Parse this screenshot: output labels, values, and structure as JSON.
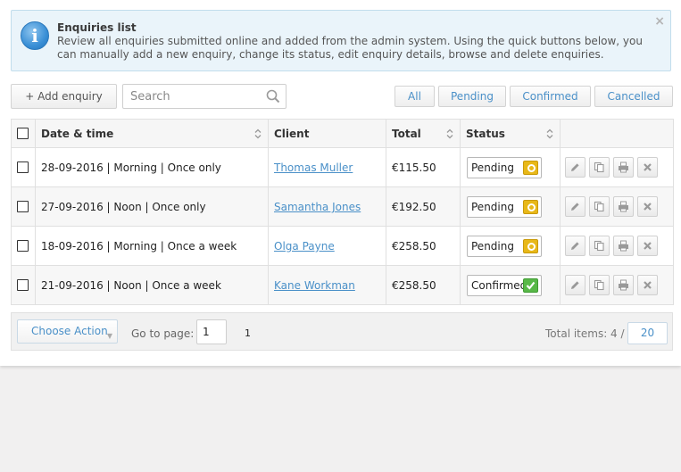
{
  "info": {
    "title": "Enquiries list",
    "text": "Review all enquiries submitted online and added from the admin system. Using the quick buttons below, you can manually add a new enquiry, change its status, edit enquiry details, browse and delete enquiries.",
    "close": "×",
    "icon_glyph": "i"
  },
  "toolbar": {
    "add_label": "+ Add enquiry",
    "search_placeholder": "Search",
    "filters": {
      "all": "All",
      "pending": "Pending",
      "confirmed": "Confirmed",
      "cancelled": "Cancelled"
    }
  },
  "table": {
    "columns": {
      "date": "Date & time",
      "client": "Client",
      "total": "Total",
      "status": "Status"
    },
    "rows": [
      {
        "date": "28-09-2016 | Morning | Once only",
        "client": "Thomas Muller",
        "total": "€115.50",
        "status": "Pending"
      },
      {
        "date": "27-09-2016 | Noon | Once only",
        "client": "Samantha Jones",
        "total": "€192.50",
        "status": "Pending"
      },
      {
        "date": "18-09-2016 | Morning | Once a week",
        "client": "Olga Payne",
        "total": "€258.50",
        "status": "Pending"
      },
      {
        "date": "21-09-2016 | Noon | Once a week",
        "client": "Kane Workman",
        "total": "€258.50",
        "status": "Confirmed"
      }
    ]
  },
  "footer": {
    "choose_action": "Choose Action",
    "goto_label": "Go to page:",
    "goto_value": "1",
    "pages_total": "1",
    "total_label": "Total items: 4 /",
    "per_page": "20"
  },
  "colors": {
    "accent": "#4a90c8",
    "pending": "#e8b818",
    "confirmed": "#58b848",
    "info_bg": "#eaf4fa"
  }
}
